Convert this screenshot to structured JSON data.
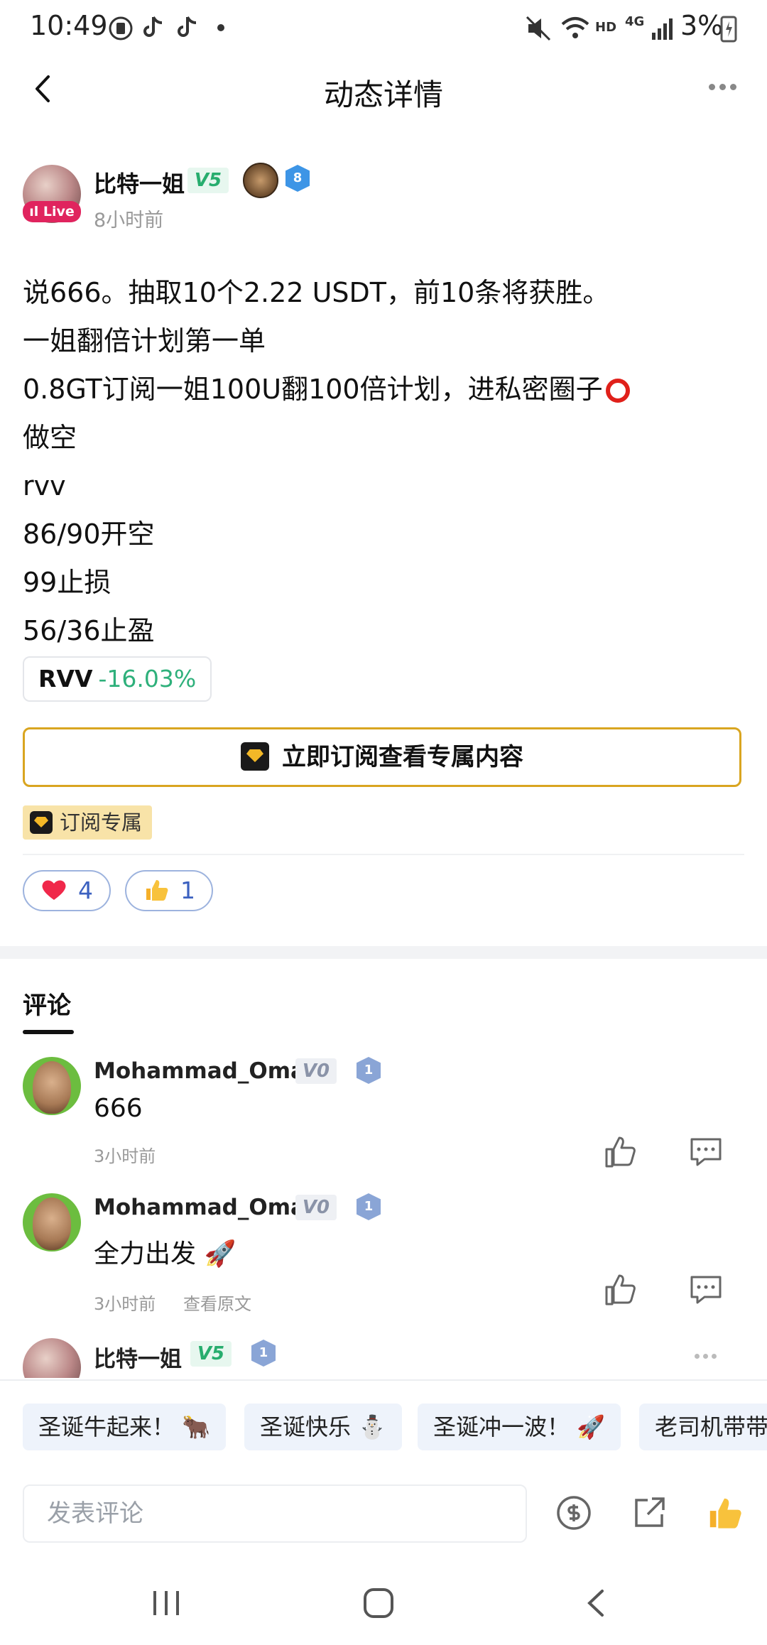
{
  "status_bar": {
    "time": "10:49",
    "network": "HD",
    "signal_label": "4G",
    "battery": "3%"
  },
  "header": {
    "title": "动态详情"
  },
  "author": {
    "name": "比特一姐",
    "level_badge": "V5",
    "rank_number": "8",
    "live_label": "Live",
    "post_time": "8小时前"
  },
  "post": {
    "lines": [
      "说666。抽取10个2.22 USDT，前10条将获胜。",
      "一姐翻倍计划第一单",
      "0.8GT订阅一姐100U翻100倍计划，进私密圈子",
      "做空",
      "rvv",
      "86/90开空",
      "99止损",
      "56/36止盈"
    ],
    "ticker": {
      "symbol": "RVV",
      "change": "-16.03%"
    },
    "subscribe_button": "立即订阅查看专属内容",
    "subscribe_tag": "订阅专属",
    "reactions": [
      {
        "icon": "heart-icon",
        "count": "4"
      },
      {
        "icon": "thumbs-up-icon",
        "count": "1"
      }
    ]
  },
  "comments_tab": "评论",
  "comments": [
    {
      "user": "Mohammad_Omar",
      "level": "V0",
      "rank": "1",
      "text": "666",
      "time": "3小时前"
    },
    {
      "user": "Mohammad_Omar",
      "level": "V0",
      "rank": "1",
      "text": "全力出发 🚀",
      "time": "3小时前",
      "extra_link": "查看原文"
    },
    {
      "user": "比特一姐",
      "level": "V5",
      "rank": "1"
    }
  ],
  "quick_replies": [
    "圣诞牛起来！ 🐂",
    "圣诞快乐 ⛄",
    "圣诞冲一波！ 🚀",
    "老司机带带"
  ],
  "input": {
    "placeholder": "发表评论"
  },
  "colors": {
    "accent_gold": "#d9a520",
    "negative_green": "#2eb07b",
    "live_red": "#e0245e",
    "level_green": "#27ad6e"
  }
}
